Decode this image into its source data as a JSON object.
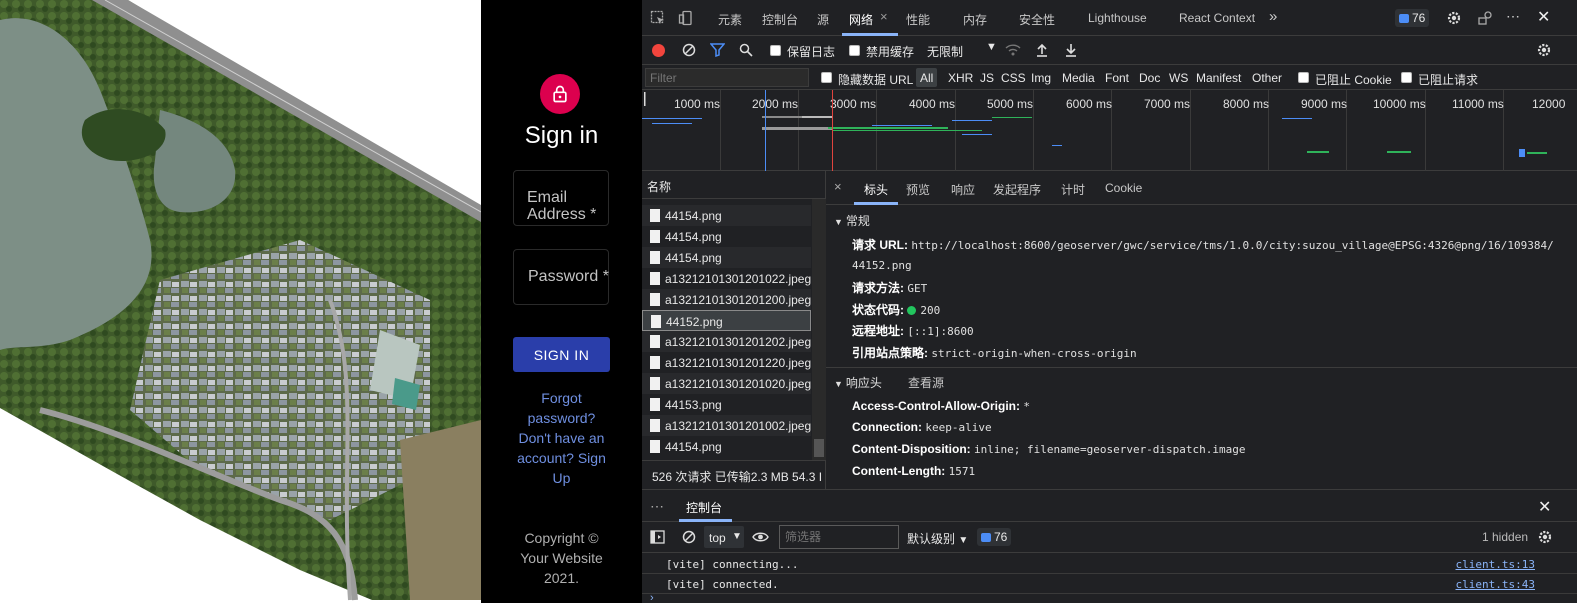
{
  "signin": {
    "title": "Sign in",
    "email_label": "Email Address *",
    "password_label": "Password *",
    "button": "SIGN IN",
    "forgot": "Forgot password?",
    "signup": "Don't have an account? Sign Up",
    "copyright": "Copyright © Your Website 2021."
  },
  "devtools": {
    "tabs": [
      "元素",
      "控制台",
      "源",
      "网络",
      "性能",
      "内存",
      "安全性",
      "Lighthouse",
      "React Context"
    ],
    "active_tab": "网络",
    "issues_count": "76",
    "toolbar": {
      "preserve_log": "保留日志",
      "disable_cache": "禁用缓存",
      "throttle": "无限制"
    },
    "filter": {
      "placeholder": "Filter",
      "hide_data_urls": "隐藏数据 URL",
      "types": [
        "All",
        "XHR",
        "JS",
        "CSS",
        "Img",
        "Media",
        "Font",
        "Doc",
        "WS",
        "Manifest",
        "Other"
      ],
      "blocked_cookies": "已阻止 Cookie",
      "blocked_requests": "已阻止请求"
    },
    "timeline_ticks": [
      "1000 ms",
      "2000 ms",
      "3000 ms",
      "4000 ms",
      "5000 ms",
      "6000 ms",
      "7000 ms",
      "8000 ms",
      "9000 ms",
      "10000 ms",
      "11000 ms",
      "12000"
    ],
    "requests": {
      "header": "名称",
      "rows": [
        "44154.png",
        "44154.png",
        "44154.png",
        "a13212101301201022.jpeg.",
        "a13212101301201200.jpeg.",
        "44152.png",
        "a13212101301201202.jpeg.",
        "a13212101301201220.jpeg.",
        "a13212101301201020.jpeg.",
        "44153.png",
        "a13212101301201002.jpeg.",
        "44154.png"
      ],
      "selected_index": 5
    },
    "status": "526 次请求  已传输2.3 MB  54.3 I",
    "details": {
      "tabs": [
        "标头",
        "预览",
        "响应",
        "发起程序",
        "计时",
        "Cookie"
      ],
      "active_tab": "标头",
      "general_title": "常规",
      "general": {
        "url_key": "请求 URL:",
        "url_val": "http://localhost:8600/geoserver/gwc/service/tms/1.0.0/city:suzou_village@EPSG:4326@png/16/109384/",
        "url_val2": "44152.png",
        "method_key": "请求方法:",
        "method_val": "GET",
        "status_key": "状态代码:",
        "status_val": "200",
        "remote_key": "远程地址:",
        "remote_val": "[::1]:8600",
        "referrer_key": "引用站点策略:",
        "referrer_val": "strict-origin-when-cross-origin"
      },
      "response_title": "响应头",
      "view_source": "查看源",
      "response_headers": [
        {
          "k": "Access-Control-Allow-Origin:",
          "v": "*"
        },
        {
          "k": "Connection:",
          "v": "keep-alive"
        },
        {
          "k": "Content-Disposition:",
          "v": "inline; filename=geoserver-dispatch.image"
        },
        {
          "k": "Content-Length:",
          "v": "1571"
        }
      ]
    },
    "console": {
      "tab": "控制台",
      "context": "top",
      "filter_placeholder": "筛选器",
      "level": "默认级别",
      "issues": "76",
      "hidden": "1 hidden",
      "logs": [
        {
          "msg": "[vite] connecting...",
          "src": "client.ts:13"
        },
        {
          "msg": "[vite] connected.",
          "src": "client.ts:43"
        }
      ]
    }
  },
  "colors": {
    "accent_red": "#dc004e",
    "signin_button": "#2a3eaa",
    "link": "#6f8fe0",
    "devtools_bg": "#202124",
    "active_blue": "#8ab4f8",
    "status_ok": "#22c55e"
  }
}
